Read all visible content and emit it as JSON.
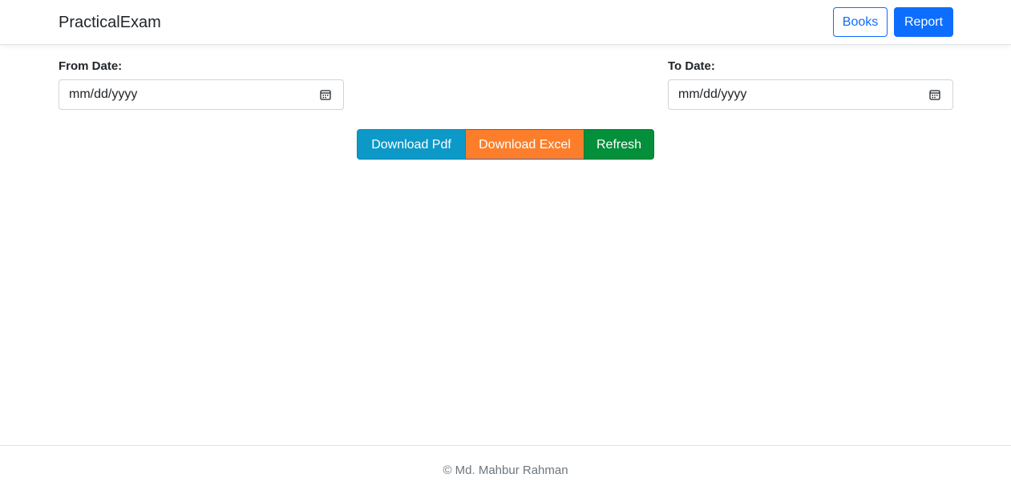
{
  "navbar": {
    "brand": "PracticalExam",
    "books_label": "Books",
    "report_label": "Report"
  },
  "filters": {
    "from_label": "From Date:",
    "from_placeholder": "mm/dd/yyyy",
    "to_label": "To Date:",
    "to_placeholder": "mm/dd/yyyy",
    "calendar_icon": "calendar-icon"
  },
  "actions": {
    "download_pdf": "Download Pdf",
    "download_excel": "Download Excel",
    "refresh": "Refresh"
  },
  "footer": {
    "text": "© Md. Mahbur Rahman"
  },
  "colors": {
    "primary": "#0d6efd",
    "info": "#0d99c8",
    "excel": "#fd7e2a",
    "success": "#048f3b"
  }
}
